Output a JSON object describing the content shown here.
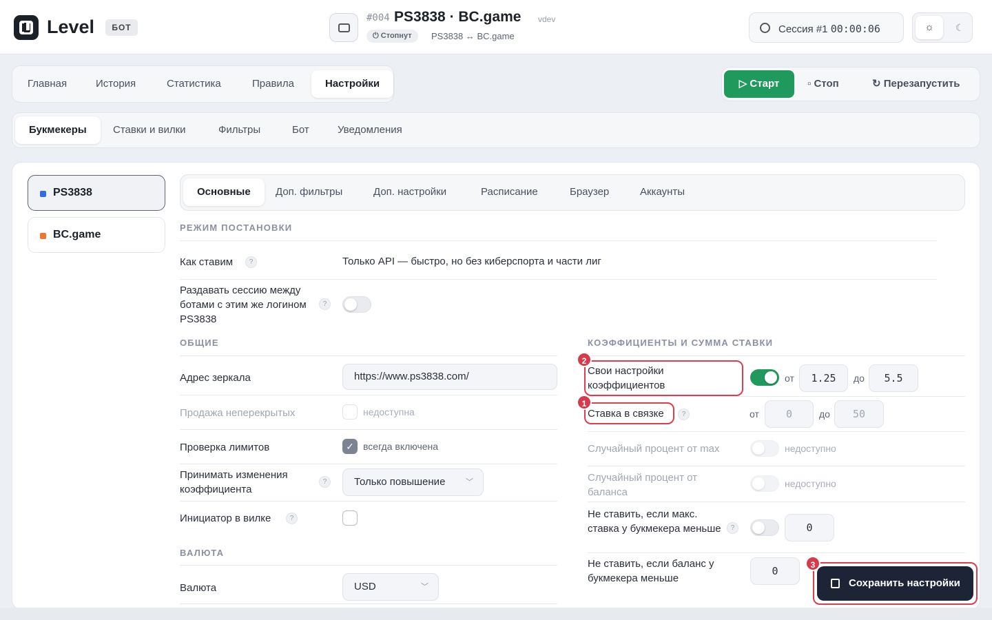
{
  "header": {
    "brand": "Level",
    "badge": "БОТ",
    "bot_number": "#004",
    "title": "PS3838 · BC.game",
    "env": "vdev",
    "status": "⏻ Стопнут",
    "pair": "PS3838 ↔ BC.game",
    "session_label": "Сессия #1",
    "session_time": "00:00:06",
    "theme_light_icon": "☼",
    "theme_dark_icon": "☾"
  },
  "main_tabs": [
    "Главная",
    "История",
    "Статистика",
    "Правила",
    "Настройки"
  ],
  "controls": {
    "start": "▷ Старт",
    "stop": "▫ Стоп",
    "restart": "↻ Перезапустить"
  },
  "sub_tabs": [
    "Букмекеры",
    "Ставки и вилки",
    "Фильтры",
    "Бот",
    "Уведомления"
  ],
  "bookmakers": [
    {
      "name": "PS3838",
      "color": "#2f6fe0"
    },
    {
      "name": "BC.game",
      "color": "#ea7a2f"
    }
  ],
  "bk_tabs": [
    "Основные",
    "Доп. фильтры",
    "Доп. настройки",
    "Расписание",
    "Браузер",
    "Аккаунты"
  ],
  "mode": {
    "section": "РЕЖИМ ПОСТАНОВКИ",
    "how_label": "Как ставим",
    "how_value": "Только API — быстро, но без киберспорта и части лиг",
    "share_label": "Раздавать сессию между ботами с этим же логином PS3838"
  },
  "general": {
    "section": "ОБЩИЕ",
    "mirror_label": "Адрес зеркала",
    "mirror_value": "https://www.ps3838.com/",
    "unmatched_label": "Продажа неперекрытых",
    "unmatched_value": "недоступна",
    "limits_label": "Проверка лимитов",
    "limits_value": "всегда включена",
    "odds_change_label": "Принимать изменения коэффициента",
    "odds_change_value": "Только повышение",
    "initiator_label": "Инициатор в вилке"
  },
  "currency": {
    "section": "ВАЛЮТА",
    "label": "Валюта",
    "value": "USD"
  },
  "odds": {
    "section": "КОЭФФИЦИЕНТЫ И СУММА СТАВКИ",
    "custom_label": "Свои настройки коэффициентов",
    "from": "от",
    "to": "до",
    "custom_min": "1.25",
    "custom_max": "5.5",
    "bundle_label": "Ставка в связке",
    "bundle_min": "0",
    "bundle_max": "50",
    "rand_max_label": "Случайный процент от max",
    "rand_max_value": "недоступно",
    "rand_bal_label": "Случайный процент от баланса",
    "rand_bal_value": "недоступно",
    "min_max_label": "Не ставить, если макс. ставка у букмекера меньше",
    "min_max_value": "0",
    "min_bal_label": "Не ставить, если баланс у букмекера меньше",
    "min_bal_value": "0",
    "save": "Сохранить настройки"
  },
  "markers": [
    "1",
    "2",
    "3"
  ],
  "help": "?"
}
